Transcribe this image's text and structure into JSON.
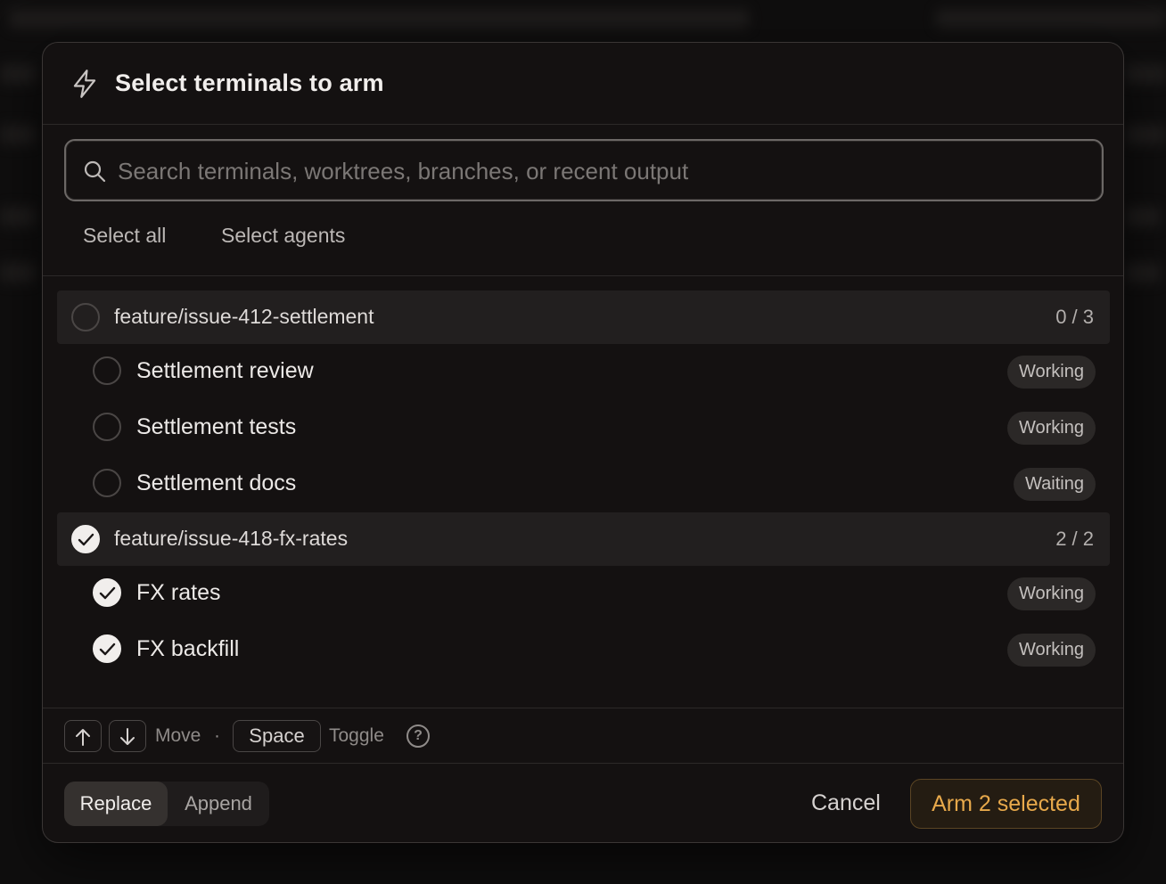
{
  "dialog": {
    "title": "Select terminals to arm",
    "search": {
      "placeholder": "Search terminals, worktrees, branches, or recent output",
      "value": ""
    },
    "quick_actions": {
      "select_all": "Select all",
      "select_agents": "Select agents"
    },
    "groups": [
      {
        "name": "feature/issue-412-settlement",
        "count": "0 / 3",
        "checked": false,
        "items": [
          {
            "label": "Settlement review",
            "status": "Working",
            "checked": false
          },
          {
            "label": "Settlement tests",
            "status": "Working",
            "checked": false
          },
          {
            "label": "Settlement docs",
            "status": "Waiting",
            "checked": false
          }
        ]
      },
      {
        "name": "feature/issue-418-fx-rates",
        "count": "2 / 2",
        "checked": true,
        "items": [
          {
            "label": "FX rates",
            "status": "Working",
            "checked": true
          },
          {
            "label": "FX backfill",
            "status": "Working",
            "checked": true
          }
        ]
      }
    ],
    "hints": {
      "move_label": "Move",
      "separator": "·",
      "space_key": "Space",
      "toggle_label": "Toggle",
      "help": "?"
    },
    "footer": {
      "mode_options": [
        "Replace",
        "Append"
      ],
      "active_mode": "Replace",
      "cancel_label": "Cancel",
      "submit_label": "Arm 2 selected"
    },
    "colors": {
      "accent": "#e8a94b",
      "accent_bg": "#241c12"
    }
  }
}
